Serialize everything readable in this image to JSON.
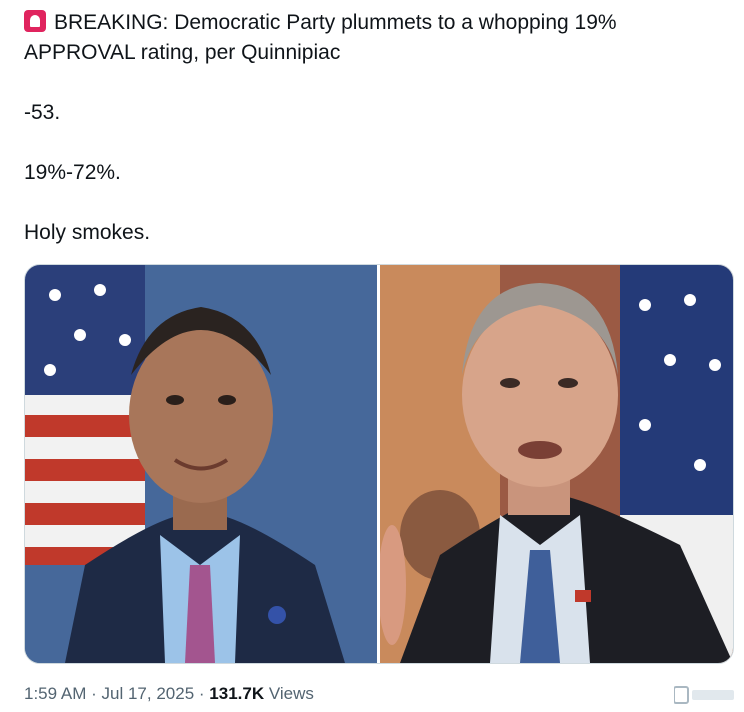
{
  "tweet": {
    "line1": "BREAKING: Democratic Party plummets to a whopping 19%",
    "line2": "APPROVAL rating, per Quinnipiac",
    "line3": "-53.",
    "line4": "19%-72%.",
    "line5": "Holy smokes.",
    "emoji": "rotating-light-icon"
  },
  "meta": {
    "time": "1:59 AM",
    "sep1": "·",
    "date": "Jul 17, 2025",
    "sep2": "·",
    "views_count": "131.7K",
    "views_label": "Views"
  },
  "colors": {
    "text": "#0f1419",
    "muted": "#536471",
    "siren": "#e0245e"
  }
}
